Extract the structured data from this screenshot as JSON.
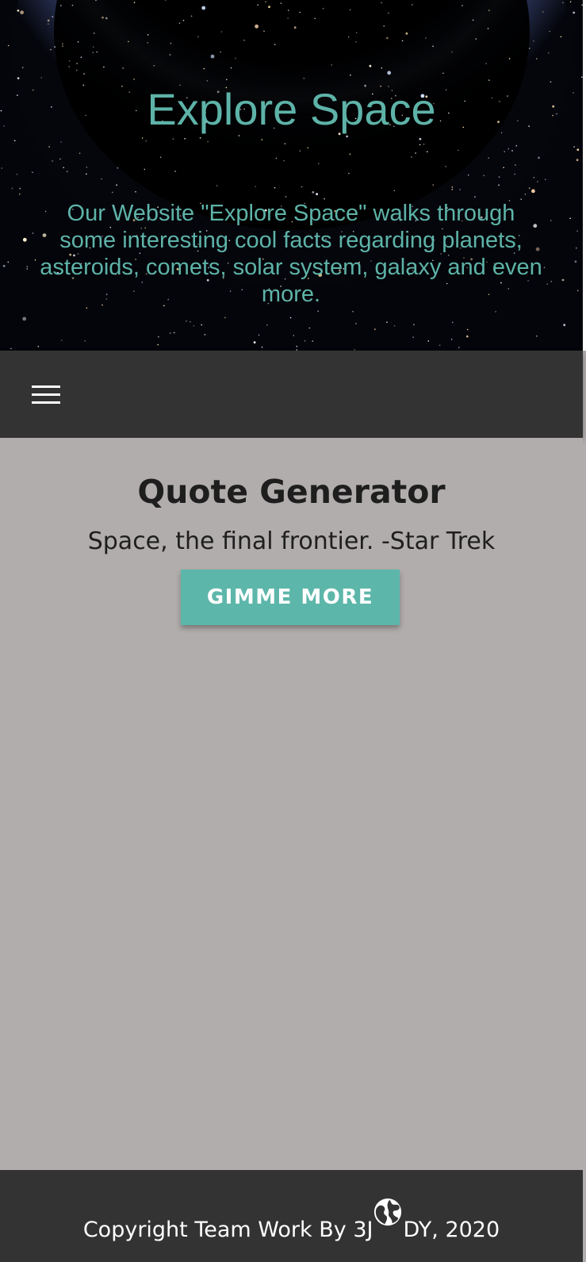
{
  "hero": {
    "title": "Explore Space",
    "description": "Our Website \"Explore Space\" walks through some interesting cool facts regarding planets, asteroids, comets, solar system, galaxy and even more."
  },
  "nav": {
    "menu_icon": "hamburger-menu-icon"
  },
  "quote": {
    "heading": "Quote Generator",
    "text": "Space, the final frontier. -Star Trek",
    "button_label": "GIMME MORE"
  },
  "footer": {
    "text_before": "Copyright Team Work By 3J",
    "icon": "globe-icon",
    "text_after": "DY, 2020"
  },
  "colors": {
    "accent": "#5eb3a8",
    "nav_bg": "#333333",
    "content_bg": "#b1adac",
    "button_bg": "#5db6aa"
  }
}
